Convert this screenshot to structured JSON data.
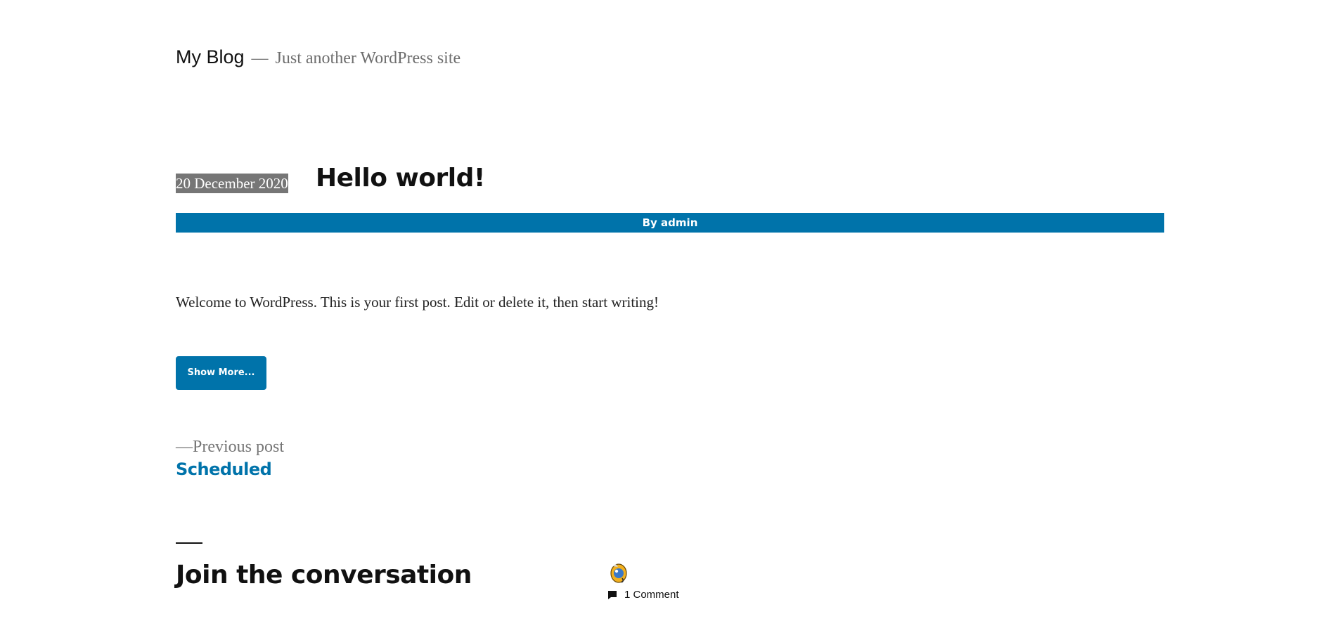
{
  "header": {
    "site_title": "My Blog",
    "separator": "—",
    "tagline": "Just another WordPress site"
  },
  "post": {
    "date": "20 December 2020",
    "title": "Hello world!",
    "byline": "By admin",
    "content": "Welcome to WordPress. This is your first post. Edit or delete it, then start writing!",
    "show_more_label": "Show More..."
  },
  "navigation": {
    "previous_meta": "—Previous post",
    "previous_title": "Scheduled"
  },
  "comments": {
    "heading": "Join the conversation",
    "count_label": "1 Comment",
    "avatar_icon": "avatar-icon",
    "comment_icon": "comment-bubble-icon"
  },
  "colors": {
    "accent": "#0073aa",
    "date_badge": "#767676",
    "text": "#111111",
    "muted": "#6d6d6d"
  }
}
